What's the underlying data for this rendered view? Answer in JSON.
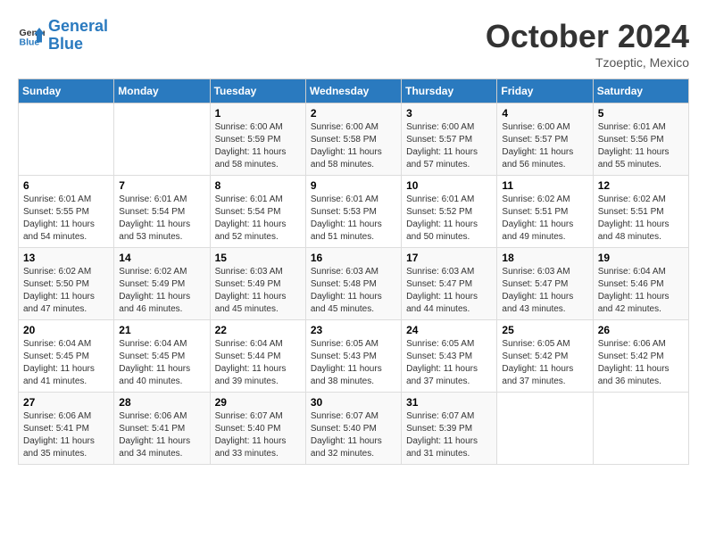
{
  "header": {
    "logo_line1": "General",
    "logo_line2": "Blue",
    "month": "October 2024",
    "location": "Tzoeptic, Mexico"
  },
  "days_of_week": [
    "Sunday",
    "Monday",
    "Tuesday",
    "Wednesday",
    "Thursday",
    "Friday",
    "Saturday"
  ],
  "weeks": [
    [
      {
        "day": "",
        "info": ""
      },
      {
        "day": "",
        "info": ""
      },
      {
        "day": "1",
        "info": "Sunrise: 6:00 AM\nSunset: 5:59 PM\nDaylight: 11 hours and 58 minutes."
      },
      {
        "day": "2",
        "info": "Sunrise: 6:00 AM\nSunset: 5:58 PM\nDaylight: 11 hours and 58 minutes."
      },
      {
        "day": "3",
        "info": "Sunrise: 6:00 AM\nSunset: 5:57 PM\nDaylight: 11 hours and 57 minutes."
      },
      {
        "day": "4",
        "info": "Sunrise: 6:00 AM\nSunset: 5:57 PM\nDaylight: 11 hours and 56 minutes."
      },
      {
        "day": "5",
        "info": "Sunrise: 6:01 AM\nSunset: 5:56 PM\nDaylight: 11 hours and 55 minutes."
      }
    ],
    [
      {
        "day": "6",
        "info": "Sunrise: 6:01 AM\nSunset: 5:55 PM\nDaylight: 11 hours and 54 minutes."
      },
      {
        "day": "7",
        "info": "Sunrise: 6:01 AM\nSunset: 5:54 PM\nDaylight: 11 hours and 53 minutes."
      },
      {
        "day": "8",
        "info": "Sunrise: 6:01 AM\nSunset: 5:54 PM\nDaylight: 11 hours and 52 minutes."
      },
      {
        "day": "9",
        "info": "Sunrise: 6:01 AM\nSunset: 5:53 PM\nDaylight: 11 hours and 51 minutes."
      },
      {
        "day": "10",
        "info": "Sunrise: 6:01 AM\nSunset: 5:52 PM\nDaylight: 11 hours and 50 minutes."
      },
      {
        "day": "11",
        "info": "Sunrise: 6:02 AM\nSunset: 5:51 PM\nDaylight: 11 hours and 49 minutes."
      },
      {
        "day": "12",
        "info": "Sunrise: 6:02 AM\nSunset: 5:51 PM\nDaylight: 11 hours and 48 minutes."
      }
    ],
    [
      {
        "day": "13",
        "info": "Sunrise: 6:02 AM\nSunset: 5:50 PM\nDaylight: 11 hours and 47 minutes."
      },
      {
        "day": "14",
        "info": "Sunrise: 6:02 AM\nSunset: 5:49 PM\nDaylight: 11 hours and 46 minutes."
      },
      {
        "day": "15",
        "info": "Sunrise: 6:03 AM\nSunset: 5:49 PM\nDaylight: 11 hours and 45 minutes."
      },
      {
        "day": "16",
        "info": "Sunrise: 6:03 AM\nSunset: 5:48 PM\nDaylight: 11 hours and 45 minutes."
      },
      {
        "day": "17",
        "info": "Sunrise: 6:03 AM\nSunset: 5:47 PM\nDaylight: 11 hours and 44 minutes."
      },
      {
        "day": "18",
        "info": "Sunrise: 6:03 AM\nSunset: 5:47 PM\nDaylight: 11 hours and 43 minutes."
      },
      {
        "day": "19",
        "info": "Sunrise: 6:04 AM\nSunset: 5:46 PM\nDaylight: 11 hours and 42 minutes."
      }
    ],
    [
      {
        "day": "20",
        "info": "Sunrise: 6:04 AM\nSunset: 5:45 PM\nDaylight: 11 hours and 41 minutes."
      },
      {
        "day": "21",
        "info": "Sunrise: 6:04 AM\nSunset: 5:45 PM\nDaylight: 11 hours and 40 minutes."
      },
      {
        "day": "22",
        "info": "Sunrise: 6:04 AM\nSunset: 5:44 PM\nDaylight: 11 hours and 39 minutes."
      },
      {
        "day": "23",
        "info": "Sunrise: 6:05 AM\nSunset: 5:43 PM\nDaylight: 11 hours and 38 minutes."
      },
      {
        "day": "24",
        "info": "Sunrise: 6:05 AM\nSunset: 5:43 PM\nDaylight: 11 hours and 37 minutes."
      },
      {
        "day": "25",
        "info": "Sunrise: 6:05 AM\nSunset: 5:42 PM\nDaylight: 11 hours and 37 minutes."
      },
      {
        "day": "26",
        "info": "Sunrise: 6:06 AM\nSunset: 5:42 PM\nDaylight: 11 hours and 36 minutes."
      }
    ],
    [
      {
        "day": "27",
        "info": "Sunrise: 6:06 AM\nSunset: 5:41 PM\nDaylight: 11 hours and 35 minutes."
      },
      {
        "day": "28",
        "info": "Sunrise: 6:06 AM\nSunset: 5:41 PM\nDaylight: 11 hours and 34 minutes."
      },
      {
        "day": "29",
        "info": "Sunrise: 6:07 AM\nSunset: 5:40 PM\nDaylight: 11 hours and 33 minutes."
      },
      {
        "day": "30",
        "info": "Sunrise: 6:07 AM\nSunset: 5:40 PM\nDaylight: 11 hours and 32 minutes."
      },
      {
        "day": "31",
        "info": "Sunrise: 6:07 AM\nSunset: 5:39 PM\nDaylight: 11 hours and 31 minutes."
      },
      {
        "day": "",
        "info": ""
      },
      {
        "day": "",
        "info": ""
      }
    ]
  ]
}
